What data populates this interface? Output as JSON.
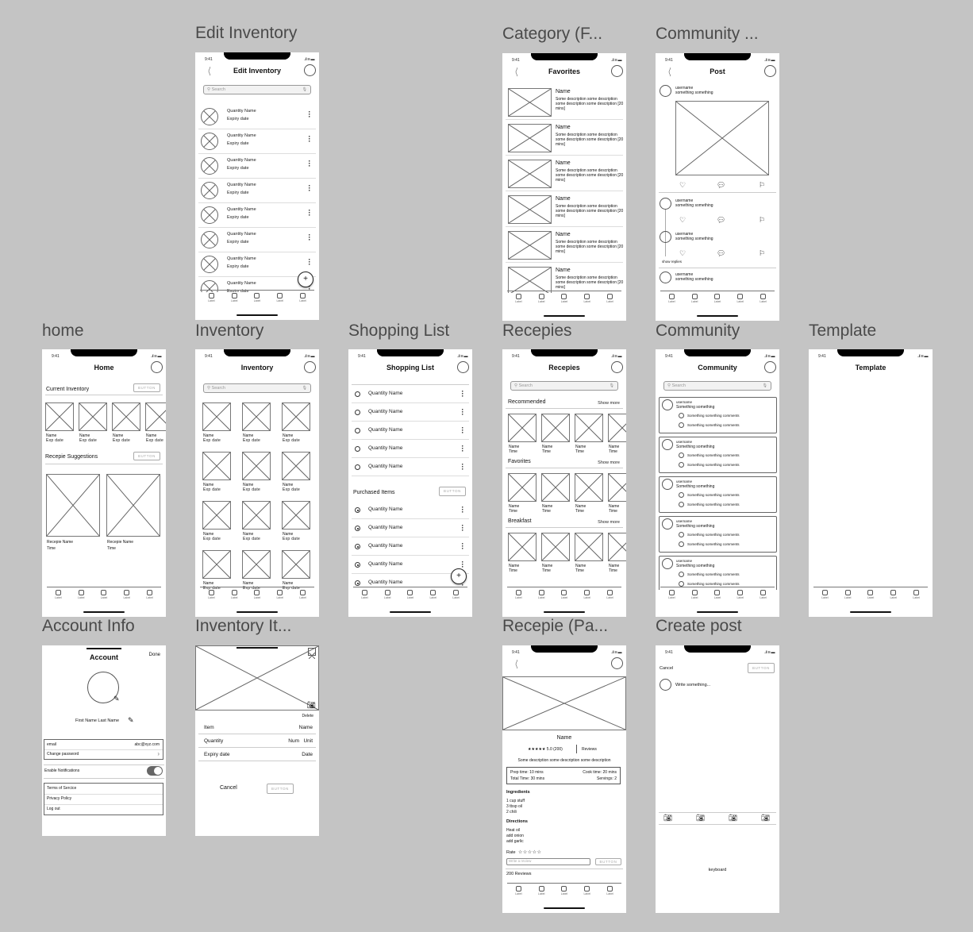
{
  "status_time": "9:41",
  "status_icons": "..ıl ≋ ▬",
  "tab_label": "Label",
  "placeholder_button": "BUTTON",
  "search_placeholder": "Search",
  "frames": {
    "edit_inventory": {
      "label": "Edit Inventory",
      "title": "Edit Inventory",
      "item_line1": "Quantity   Name",
      "item_line2": "Expiry date",
      "fab": "+"
    },
    "category": {
      "label": "Category (F...",
      "title": "Favorites",
      "item_name": "Name",
      "item_desc": "Some description some description some description some description [20 mins]"
    },
    "community_post": {
      "label": "Community ...",
      "title": "Post",
      "username": "username",
      "subtext": "something something",
      "show_replies": "show replies"
    },
    "home": {
      "label": "home",
      "title": "Home",
      "current_inventory": "Current Inventory",
      "item_name": "Name",
      "item_exp": "Exp date",
      "recipe_suggestions": "Recepie Suggestions",
      "recipe_name": "Recepie Name",
      "recipe_time": "Time"
    },
    "inventory": {
      "label": "Inventory",
      "title": "Inventory",
      "item_name": "Name",
      "item_exp": "Exp date"
    },
    "shopping_list": {
      "label": "Shopping List",
      "title": "Shopping List",
      "item_text": "Quantity   Name",
      "purchased": "Purchased Items",
      "fab": "+"
    },
    "recipes": {
      "label": "Recepies",
      "title": "Recepies",
      "sections": [
        "Recommended",
        "Favorites",
        "Breakfast"
      ],
      "show_more": "Show more",
      "item_name": "Name",
      "item_time": "Time"
    },
    "community": {
      "label": "Community",
      "title": "Community",
      "username": "username",
      "post_text": "Something something",
      "comment": "Something something comments"
    },
    "template": {
      "label": "Template",
      "title": "Template"
    },
    "account": {
      "label": "Account Info",
      "title": "Account",
      "done": "Done",
      "name": "First Name Last Name",
      "email_label": "email",
      "email_value": "abc@xyz.com",
      "change_password": "Change password",
      "notifications": "Enable Notifications",
      "notifications_on": true,
      "terms": "Terms of Sercice",
      "privacy": "Privacy Policy",
      "logout": "Log out"
    },
    "inventory_item": {
      "label": "Inventory It...",
      "delete": "Delete",
      "fields": [
        {
          "label": "Item",
          "value": "Name"
        },
        {
          "label": "Quantity",
          "value": "Num   Unit"
        },
        {
          "label": "Expiry date",
          "value": "Date"
        }
      ],
      "cancel": "Cancel"
    },
    "recipe_page": {
      "label": "Recepie (Pa...",
      "name": "Name",
      "rating": "★★★★★ 5.0 (200)",
      "reviews_link": "Reviews",
      "description": "Some description some description some description",
      "prep": "Prep time: 10 mins",
      "cook": "Cook time: 20 mins",
      "total": "Total Time: 30 mins",
      "servings": "Servings: 2",
      "ingredients_title": "Ingredients",
      "ingredients": [
        "1 cup stuff",
        "3 tbsp oil",
        "2 chili"
      ],
      "directions_title": "Directions",
      "directions": [
        "Heat oil",
        "add onion",
        "add garlic"
      ],
      "rate_label": "Rate",
      "rate_stars": "☆☆☆☆☆",
      "review_placeholder": "Write a review",
      "reviews_count": "200 Reviews"
    },
    "create_post": {
      "label": "Create post",
      "cancel": "Cancel",
      "placeholder": "Write something...",
      "keyboard": "keyboard"
    }
  }
}
